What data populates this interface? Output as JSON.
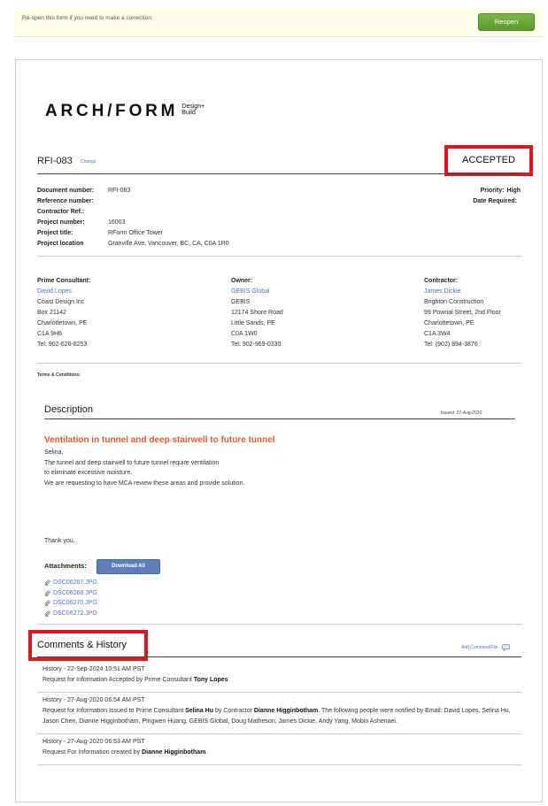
{
  "reopen": {
    "message": "Re-open this form if you need to make a correction.",
    "button": "Reopen"
  },
  "logo": {
    "main": "ARCH/FORM",
    "sub1": "Design+",
    "sub2": "Build"
  },
  "header": {
    "rfi": "RFI-083",
    "change": "Change",
    "status": "ACCEPTED"
  },
  "info_left": [
    {
      "label": "Document number:",
      "value": "RFI-083"
    },
    {
      "label": "Reference number:",
      "value": ""
    },
    {
      "label": "Contractor Ref.:",
      "value": ""
    },
    {
      "label": "Project number:",
      "value": "16003"
    },
    {
      "label": "Project title:",
      "value": "RForm Office Tower"
    },
    {
      "label": "Project location",
      "value": "Granville Ave, Vancouver, BC, CA, C0A 1R0"
    }
  ],
  "info_right": [
    {
      "label": "Priority:",
      "value": "High"
    },
    {
      "label": "Date Required:",
      "value": ""
    }
  ],
  "parties": [
    {
      "role": "Prime Consultant:",
      "contact": "David Lopes",
      "company": "Coast Design Inc",
      "address1": "Box 21142",
      "city": "Charlottetown, PE",
      "postal": "C1A 9H6",
      "tel": "Tel: 902-626-8253"
    },
    {
      "role": "Owner:",
      "contact": "GEBIS Global",
      "company": "GEBIS",
      "address1": "12174 Shore Road",
      "city": "Little Sands, PE",
      "postal": "C0A 1W0",
      "tel": "Tel: 902-969-0330"
    },
    {
      "role": "Contractor:",
      "contact": "James Dickie",
      "company": "Brighton Construction",
      "address1": "99 Pownal Street, 2nd Floor",
      "city": "Charlottetown, PE",
      "postal": "C1A 3W4",
      "tel": "Tel: (902) 894-3876"
    }
  ],
  "terms": "Terms & Conditions:",
  "description": {
    "title": "Description",
    "issued": "Issued: 27-Aug-2020",
    "subject": "Ventilation in tunnel and deep stairwell to future tunnel",
    "lines": [
      "Selina,",
      "The tunnel and deep stairwell to future tunnel require ventilation",
      "to eliminate excessive moisture.",
      "We are requesting to have MCA review these areas and provide solution."
    ],
    "thanks": "Thank you."
  },
  "attachments": {
    "label": "Attachments:",
    "download_all": "Download All",
    "files": [
      "DSC06267.JPG",
      "DSC06268.JPG",
      "DSC06270.JPG",
      "DSC06272.JPG"
    ]
  },
  "comments": {
    "title": "Comments & History",
    "add": "Add Comment/File"
  },
  "history": [
    {
      "header": "History - 22-Sep-2024 10:51 AM PST",
      "t1": "Request for Information Accepted by Prime Consultant ",
      "b1": "Tony Lopes",
      "t2": "",
      "b2": "",
      "t3": ""
    },
    {
      "header": "History - 27-Aug-2020 06:54 AM PST",
      "t1": "Request for Information Issued to Prime Consultant ",
      "b1": "Selina Hu",
      "t2": " by Contractor ",
      "b2": "Dianne Higginbotham",
      "t3": ". The following people were notified by Email: David Lopes, Selina Hu, Jason Chen, Dianne Higginbotham, Pingwen Huang, GEBIS Global, Doug Matheson, James Dickie, Andy Yang, Mobin Ashenaei."
    },
    {
      "header": "History - 27-Aug-2020 06:53 AM PST",
      "t1": "Request For Information created by ",
      "b1": "Dianne Higginbotham",
      "t2": ".",
      "b2": "",
      "t3": ""
    }
  ]
}
